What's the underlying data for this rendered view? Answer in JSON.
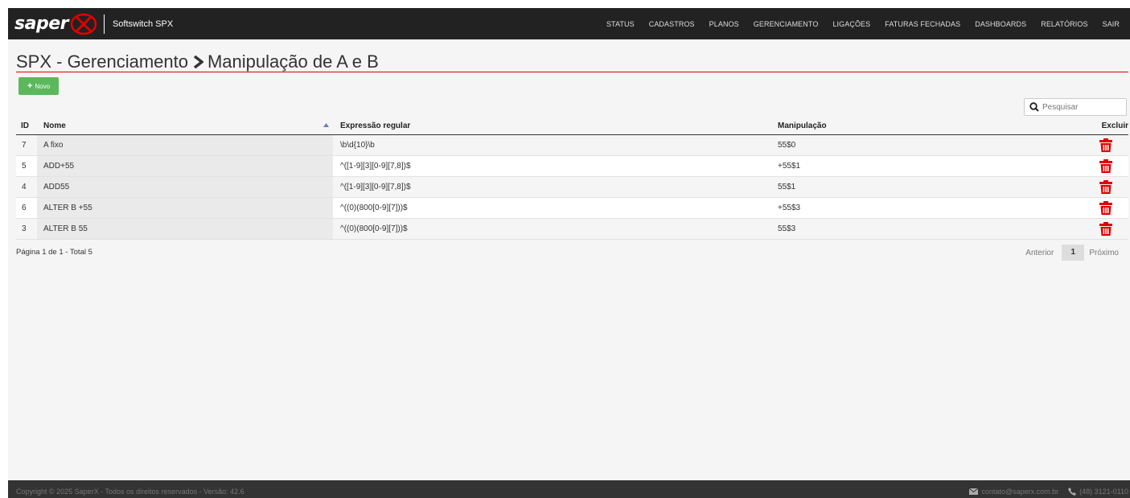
{
  "brand": {
    "logo_text": "saper",
    "subtitle": "Softswitch SPX"
  },
  "nav": [
    "STATUS",
    "CADASTROS",
    "PLANOS",
    "GERENCIAMENTO",
    "LIGAÇÕES",
    "FATURAS FECHADAS",
    "DASHBOARDS",
    "RELATÓRIOS",
    "SAIR"
  ],
  "page": {
    "title_section": "SPX - Gerenciamento",
    "title_page": "Manipulação de A e B",
    "new_button": "Novo",
    "search_placeholder": "Pesquisar"
  },
  "table": {
    "headers": {
      "id": "ID",
      "name": "Nome",
      "regex": "Expressão regular",
      "manip": "Manipulação",
      "delete": "Excluir"
    },
    "rows": [
      {
        "id": "7",
        "name": "A fixo",
        "regex": "\\b\\d{10}\\b",
        "manip": "55$0"
      },
      {
        "id": "5",
        "name": "ADD+55",
        "regex": "^([1-9][3][0-9][7,8])$",
        "manip": "+55$1"
      },
      {
        "id": "4",
        "name": "ADD55",
        "regex": "^([1-9][3][0-9][7,8])$",
        "manip": "55$1"
      },
      {
        "id": "6",
        "name": "ALTER B +55",
        "regex": "^((0)(800[0-9][7]))$",
        "manip": "+55$3"
      },
      {
        "id": "3",
        "name": "ALTER B 55",
        "regex": "^((0)(800[0-9][7]))$",
        "manip": "55$3"
      }
    ]
  },
  "pagination": {
    "info": "Página 1 de 1 - Total 5",
    "prev": "Anterior",
    "current": "1",
    "next": "Próximo"
  },
  "footer": {
    "copyright": "Copyright © 2025 SaperX - Todos os direitos reservados - Versão: 42.6",
    "email": "contato@saperx.com.br",
    "phone": "(48) 3121-0110"
  },
  "colors": {
    "accent_red": "#e00000",
    "new_button_green": "#5cb85c",
    "trash_red": "#e00000"
  },
  "icons": {
    "new_button": "plus-icon",
    "search": "search-icon",
    "delete": "trash-icon",
    "email": "envelope-icon",
    "phone": "phone-icon",
    "sort": "sort-asc-icon",
    "breadcrumb": "chevron-right-icon"
  }
}
